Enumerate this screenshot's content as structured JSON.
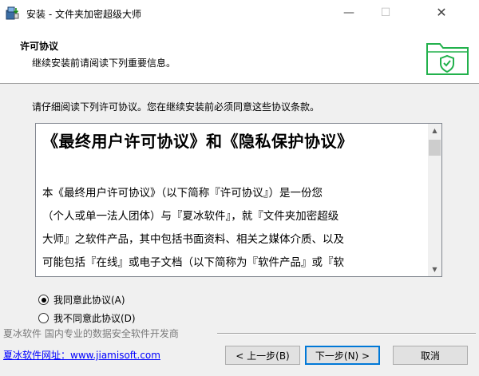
{
  "window": {
    "title": "安装 - 文件夹加密超级大师",
    "minimize_glyph": "—",
    "maximize_glyph": "☐",
    "close_glyph": "✕"
  },
  "header": {
    "title": "许可协议",
    "subtitle": "继续安装前请阅读下列重要信息。",
    "icon": "folder-shield-icon",
    "accent_color": "#22b14c"
  },
  "instruction": "请仔细阅读下列许可协议。您在继续安装前必须同意这些协议条款。",
  "license": {
    "heading": "《最终用户许可协议》和《隐私保护协议》",
    "lines": [
      "本《最终用户许可协议》（以下简称『许可协议』）是一份您",
      "（个人或单一法人团体）与『夏冰软件』，就『文件夹加密超级",
      "大师』之软件产品，其中包括书面资料、相关之媒体介质、以及",
      "可能包括『在线』或电子文档（以下简称为『软件产品』或『软"
    ],
    "scroll_up_glyph": "▲",
    "scroll_down_glyph": "▼"
  },
  "options": {
    "accept_label": "我同意此协议(A)",
    "decline_label": "我不同意此协议(D)",
    "selected": "accept"
  },
  "footer": {
    "watermark": "夏冰软件 国内专业的数据安全软件开发商",
    "site_link": "夏冰软件网址：www.jiamisoft.com"
  },
  "buttons": {
    "back": "< 上一步(B)",
    "next": "下一步(N) >",
    "cancel": "取消"
  }
}
